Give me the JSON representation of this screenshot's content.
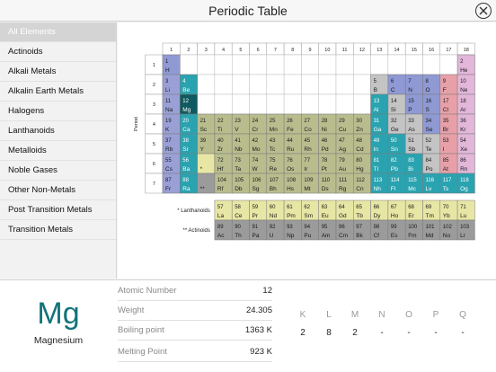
{
  "app": {
    "title": "Periodic Table"
  },
  "sidebar": {
    "items": [
      {
        "label": "All Elements",
        "active": true
      },
      {
        "label": "Actinoids"
      },
      {
        "label": "Alkali Metals"
      },
      {
        "label": "Alkalin Earth Metals"
      },
      {
        "label": "Halogens"
      },
      {
        "label": "Lanthanoids"
      },
      {
        "label": "Metalloids"
      },
      {
        "label": "Noble Gases"
      },
      {
        "label": "Other Non-Metals"
      },
      {
        "label": "Post Transition Metals"
      },
      {
        "label": "Transition Metals"
      }
    ]
  },
  "table": {
    "group_axis_label": "Group",
    "period_axis_label": "Period",
    "groups": [
      "1",
      "2",
      "3",
      "4",
      "5",
      "6",
      "7",
      "8",
      "9",
      "10",
      "11",
      "12",
      "13",
      "14",
      "15",
      "16",
      "17",
      "18"
    ],
    "periods": [
      "1",
      "2",
      "3",
      "4",
      "5",
      "6",
      "7"
    ],
    "lanthanoids_label": "* Lanthanoids",
    "actinoids_label": "** Actinoids",
    "colors": {
      "alkali": "#9aa0d6",
      "alkaline": "#2aa3b0",
      "transition": "#b9bd8e",
      "post_transition": "#2aa3b0",
      "metalloid": "#2aa3b0",
      "nonmetal": "#8f99d4",
      "halogen": "#e7a0a8",
      "noble": "#e2b7d9",
      "lanthanoid": "#e8e6a4",
      "actinoid": "#9b9b9b",
      "gray": "#c4c4c4",
      "selected": "#0f5a60"
    },
    "elements": [
      {
        "n": 1,
        "s": "H",
        "p": 1,
        "g": 1,
        "c": "nonmetal"
      },
      {
        "n": 2,
        "s": "He",
        "p": 1,
        "g": 18,
        "c": "noble"
      },
      {
        "n": 3,
        "s": "Li",
        "p": 2,
        "g": 1,
        "c": "alkali"
      },
      {
        "n": 4,
        "s": "Be",
        "p": 2,
        "g": 2,
        "c": "alkaline"
      },
      {
        "n": 5,
        "s": "B",
        "p": 2,
        "g": 13,
        "c": "gray"
      },
      {
        "n": 6,
        "s": "C",
        "p": 2,
        "g": 14,
        "c": "nonmetal"
      },
      {
        "n": 7,
        "s": "N",
        "p": 2,
        "g": 15,
        "c": "nonmetal"
      },
      {
        "n": 8,
        "s": "O",
        "p": 2,
        "g": 16,
        "c": "nonmetal"
      },
      {
        "n": 9,
        "s": "F",
        "p": 2,
        "g": 17,
        "c": "halogen"
      },
      {
        "n": 10,
        "s": "Ne",
        "p": 2,
        "g": 18,
        "c": "noble"
      },
      {
        "n": 11,
        "s": "Na",
        "p": 3,
        "g": 1,
        "c": "alkali"
      },
      {
        "n": 12,
        "s": "Mg",
        "p": 3,
        "g": 2,
        "c": "selected"
      },
      {
        "n": 13,
        "s": "Al",
        "p": 3,
        "g": 13,
        "c": "post_transition"
      },
      {
        "n": 14,
        "s": "Si",
        "p": 3,
        "g": 14,
        "c": "gray"
      },
      {
        "n": 15,
        "s": "P",
        "p": 3,
        "g": 15,
        "c": "nonmetal"
      },
      {
        "n": 16,
        "s": "S",
        "p": 3,
        "g": 16,
        "c": "nonmetal"
      },
      {
        "n": 17,
        "s": "Cl",
        "p": 3,
        "g": 17,
        "c": "halogen"
      },
      {
        "n": 18,
        "s": "Ar",
        "p": 3,
        "g": 18,
        "c": "noble"
      },
      {
        "n": 19,
        "s": "K",
        "p": 4,
        "g": 1,
        "c": "alkali"
      },
      {
        "n": 20,
        "s": "Ca",
        "p": 4,
        "g": 2,
        "c": "alkaline"
      },
      {
        "n": 21,
        "s": "Sc",
        "p": 4,
        "g": 3,
        "c": "transition"
      },
      {
        "n": 22,
        "s": "Ti",
        "p": 4,
        "g": 4,
        "c": "transition"
      },
      {
        "n": 23,
        "s": "V",
        "p": 4,
        "g": 5,
        "c": "transition"
      },
      {
        "n": 24,
        "s": "Cr",
        "p": 4,
        "g": 6,
        "c": "transition"
      },
      {
        "n": 25,
        "s": "Mn",
        "p": 4,
        "g": 7,
        "c": "transition"
      },
      {
        "n": 26,
        "s": "Fe",
        "p": 4,
        "g": 8,
        "c": "transition"
      },
      {
        "n": 27,
        "s": "Co",
        "p": 4,
        "g": 9,
        "c": "transition"
      },
      {
        "n": 28,
        "s": "Ni",
        "p": 4,
        "g": 10,
        "c": "transition"
      },
      {
        "n": 29,
        "s": "Cu",
        "p": 4,
        "g": 11,
        "c": "transition"
      },
      {
        "n": 30,
        "s": "Zn",
        "p": 4,
        "g": 12,
        "c": "transition"
      },
      {
        "n": 31,
        "s": "Ga",
        "p": 4,
        "g": 13,
        "c": "post_transition"
      },
      {
        "n": 32,
        "s": "Ge",
        "p": 4,
        "g": 14,
        "c": "gray"
      },
      {
        "n": 33,
        "s": "As",
        "p": 4,
        "g": 15,
        "c": "gray"
      },
      {
        "n": 34,
        "s": "Se",
        "p": 4,
        "g": 16,
        "c": "nonmetal"
      },
      {
        "n": 35,
        "s": "Br",
        "p": 4,
        "g": 17,
        "c": "halogen"
      },
      {
        "n": 36,
        "s": "Kr",
        "p": 4,
        "g": 18,
        "c": "noble"
      },
      {
        "n": 37,
        "s": "Rb",
        "p": 5,
        "g": 1,
        "c": "alkali"
      },
      {
        "n": 38,
        "s": "Sr",
        "p": 5,
        "g": 2,
        "c": "alkaline"
      },
      {
        "n": 39,
        "s": "Y",
        "p": 5,
        "g": 3,
        "c": "transition"
      },
      {
        "n": 40,
        "s": "Zr",
        "p": 5,
        "g": 4,
        "c": "transition"
      },
      {
        "n": 41,
        "s": "Nb",
        "p": 5,
        "g": 5,
        "c": "transition"
      },
      {
        "n": 42,
        "s": "Mo",
        "p": 5,
        "g": 6,
        "c": "transition"
      },
      {
        "n": 43,
        "s": "Tc",
        "p": 5,
        "g": 7,
        "c": "transition"
      },
      {
        "n": 44,
        "s": "Ru",
        "p": 5,
        "g": 8,
        "c": "transition"
      },
      {
        "n": 45,
        "s": "Rh",
        "p": 5,
        "g": 9,
        "c": "transition"
      },
      {
        "n": 46,
        "s": "Pd",
        "p": 5,
        "g": 10,
        "c": "transition"
      },
      {
        "n": 47,
        "s": "Ag",
        "p": 5,
        "g": 11,
        "c": "transition"
      },
      {
        "n": 48,
        "s": "Cd",
        "p": 5,
        "g": 12,
        "c": "transition"
      },
      {
        "n": 49,
        "s": "In",
        "p": 5,
        "g": 13,
        "c": "post_transition"
      },
      {
        "n": 50,
        "s": "Sn",
        "p": 5,
        "g": 14,
        "c": "post_transition"
      },
      {
        "n": 51,
        "s": "Sb",
        "p": 5,
        "g": 15,
        "c": "gray"
      },
      {
        "n": 52,
        "s": "Te",
        "p": 5,
        "g": 16,
        "c": "gray"
      },
      {
        "n": 53,
        "s": "I",
        "p": 5,
        "g": 17,
        "c": "halogen"
      },
      {
        "n": 54,
        "s": "Xe",
        "p": 5,
        "g": 18,
        "c": "noble"
      },
      {
        "n": 55,
        "s": "Cs",
        "p": 6,
        "g": 1,
        "c": "alkali"
      },
      {
        "n": 56,
        "s": "Ba",
        "p": 6,
        "g": 2,
        "c": "alkaline"
      },
      {
        "n": "",
        "s": "*",
        "p": 6,
        "g": 3,
        "c": "lanthanoid"
      },
      {
        "n": 72,
        "s": "Hf",
        "p": 6,
        "g": 4,
        "c": "transition"
      },
      {
        "n": 73,
        "s": "Ta",
        "p": 6,
        "g": 5,
        "c": "transition"
      },
      {
        "n": 74,
        "s": "W",
        "p": 6,
        "g": 6,
        "c": "transition"
      },
      {
        "n": 75,
        "s": "Re",
        "p": 6,
        "g": 7,
        "c": "transition"
      },
      {
        "n": 76,
        "s": "Os",
        "p": 6,
        "g": 8,
        "c": "transition"
      },
      {
        "n": 77,
        "s": "Ir",
        "p": 6,
        "g": 9,
        "c": "transition"
      },
      {
        "n": 78,
        "s": "Pt",
        "p": 6,
        "g": 10,
        "c": "transition"
      },
      {
        "n": 79,
        "s": "Au",
        "p": 6,
        "g": 11,
        "c": "transition"
      },
      {
        "n": 80,
        "s": "Hg",
        "p": 6,
        "g": 12,
        "c": "transition"
      },
      {
        "n": 81,
        "s": "Tl",
        "p": 6,
        "g": 13,
        "c": "post_transition"
      },
      {
        "n": 82,
        "s": "Pb",
        "p": 6,
        "g": 14,
        "c": "post_transition"
      },
      {
        "n": 83,
        "s": "Bi",
        "p": 6,
        "g": 15,
        "c": "post_transition"
      },
      {
        "n": 84,
        "s": "Po",
        "p": 6,
        "g": 16,
        "c": "gray"
      },
      {
        "n": 85,
        "s": "At",
        "p": 6,
        "g": 17,
        "c": "halogen"
      },
      {
        "n": 86,
        "s": "Rn",
        "p": 6,
        "g": 18,
        "c": "noble"
      },
      {
        "n": 87,
        "s": "Fr",
        "p": 7,
        "g": 1,
        "c": "alkali"
      },
      {
        "n": 88,
        "s": "Ra",
        "p": 7,
        "g": 2,
        "c": "alkaline"
      },
      {
        "n": "",
        "s": "**",
        "p": 7,
        "g": 3,
        "c": "actinoid"
      },
      {
        "n": 104,
        "s": "Rf",
        "p": 7,
        "g": 4,
        "c": "transition"
      },
      {
        "n": 105,
        "s": "Db",
        "p": 7,
        "g": 5,
        "c": "transition"
      },
      {
        "n": 106,
        "s": "Sg",
        "p": 7,
        "g": 6,
        "c": "transition"
      },
      {
        "n": 107,
        "s": "Bh",
        "p": 7,
        "g": 7,
        "c": "transition"
      },
      {
        "n": 108,
        "s": "Hs",
        "p": 7,
        "g": 8,
        "c": "transition"
      },
      {
        "n": 109,
        "s": "Mt",
        "p": 7,
        "g": 9,
        "c": "transition"
      },
      {
        "n": 110,
        "s": "Ds",
        "p": 7,
        "g": 10,
        "c": "transition"
      },
      {
        "n": 111,
        "s": "Rg",
        "p": 7,
        "g": 11,
        "c": "transition"
      },
      {
        "n": 112,
        "s": "Cn",
        "p": 7,
        "g": 12,
        "c": "transition"
      },
      {
        "n": 113,
        "s": "Nh",
        "p": 7,
        "g": 13,
        "c": "post_transition"
      },
      {
        "n": 114,
        "s": "Fl",
        "p": 7,
        "g": 14,
        "c": "post_transition"
      },
      {
        "n": 115,
        "s": "Mc",
        "p": 7,
        "g": 15,
        "c": "post_transition"
      },
      {
        "n": 116,
        "s": "Lv",
        "p": 7,
        "g": 16,
        "c": "post_transition"
      },
      {
        "n": 117,
        "s": "Ts",
        "p": 7,
        "g": 17,
        "c": "post_transition"
      },
      {
        "n": 118,
        "s": "Og",
        "p": 7,
        "g": 18,
        "c": "post_transition"
      }
    ],
    "lanthanoids": [
      {
        "n": 57,
        "s": "La"
      },
      {
        "n": 58,
        "s": "Ce"
      },
      {
        "n": 59,
        "s": "Pr"
      },
      {
        "n": 60,
        "s": "Nd"
      },
      {
        "n": 61,
        "s": "Pm"
      },
      {
        "n": 62,
        "s": "Sm"
      },
      {
        "n": 63,
        "s": "Eu"
      },
      {
        "n": 64,
        "s": "Gd"
      },
      {
        "n": 65,
        "s": "Tb"
      },
      {
        "n": 66,
        "s": "Dy"
      },
      {
        "n": 67,
        "s": "Ho"
      },
      {
        "n": 68,
        "s": "Er"
      },
      {
        "n": 69,
        "s": "Tm"
      },
      {
        "n": 70,
        "s": "Yb"
      },
      {
        "n": 71,
        "s": "Lu"
      }
    ],
    "actinoids": [
      {
        "n": 89,
        "s": "Ac"
      },
      {
        "n": 90,
        "s": "Th"
      },
      {
        "n": 91,
        "s": "Pa"
      },
      {
        "n": 92,
        "s": "U"
      },
      {
        "n": 93,
        "s": "Np"
      },
      {
        "n": 94,
        "s": "Pu"
      },
      {
        "n": 95,
        "s": "Am"
      },
      {
        "n": 96,
        "s": "Cm"
      },
      {
        "n": 97,
        "s": "Bk"
      },
      {
        "n": 98,
        "s": "Cf"
      },
      {
        "n": 99,
        "s": "Es"
      },
      {
        "n": 100,
        "s": "Fm"
      },
      {
        "n": 101,
        "s": "Md"
      },
      {
        "n": 102,
        "s": "No"
      },
      {
        "n": 103,
        "s": "Lr"
      }
    ]
  },
  "detail": {
    "symbol": "Mg",
    "name": "Magnesium",
    "properties": [
      {
        "label": "Atomic Number",
        "value": "12"
      },
      {
        "label": "Weight",
        "value": "24.305"
      },
      {
        "label": "Boiling point",
        "value": "1363 K"
      },
      {
        "label": "Melting Point",
        "value": "923 K"
      }
    ],
    "shells": [
      {
        "name": "K",
        "value": "2"
      },
      {
        "name": "L",
        "value": "8"
      },
      {
        "name": "M",
        "value": "2"
      },
      {
        "name": "N",
        "value": "-"
      },
      {
        "name": "O",
        "value": "-"
      },
      {
        "name": "P",
        "value": "-"
      },
      {
        "name": "Q",
        "value": "-"
      }
    ]
  }
}
